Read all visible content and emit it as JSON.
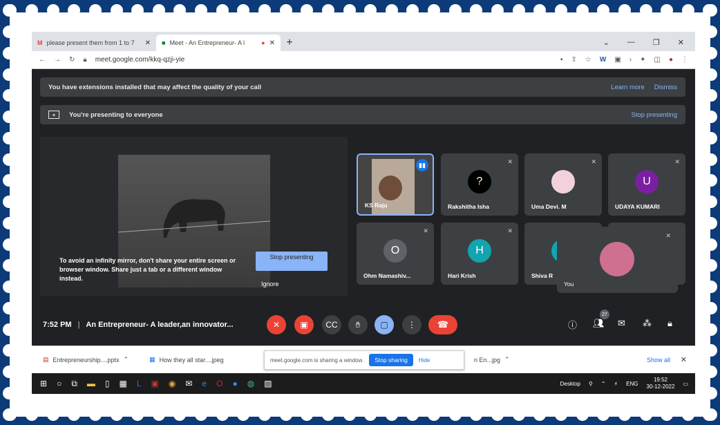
{
  "browser": {
    "tabs": [
      {
        "title": "please present them from 1 to 7",
        "icon": "gmail-icon"
      },
      {
        "title": "Meet - An Entrepreneur- A l",
        "icon": "meet-icon"
      }
    ],
    "url": "meet.google.com/kkq-qzji-yie"
  },
  "meet": {
    "ext_warning": "You have extensions installed that may affect the quality of your call",
    "learn_more": "Learn more",
    "dismiss": "Dismiss",
    "presenting": "You're presenting to everyone",
    "stop_presenting_link": "Stop presenting",
    "mirror_warning": "To avoid an infinity mirror, don't share your entire screen or browser window. Share just a tab or a different window instead.",
    "stop_presenting_btn": "Stop presenting",
    "ignore": "Ignore",
    "participants": [
      {
        "name": "KS Raju",
        "initial": "",
        "color": "#6b8",
        "speaking": true
      },
      {
        "name": "Rakshitha Isha",
        "initial": "?",
        "color": "#000"
      },
      {
        "name": "Uma Devi. M",
        "initial": "",
        "color": "#f3d1dc"
      },
      {
        "name": "UDAYA KUMARI",
        "initial": "U",
        "color": "#7b1fa2"
      },
      {
        "name": "Ohm Namashiv...",
        "initial": "O",
        "color": "#5f6368"
      },
      {
        "name": "Hari Krish",
        "initial": "H",
        "color": "#12a4af"
      },
      {
        "name": "Shiva R",
        "initial": "",
        "color": "#12a4af"
      }
    ],
    "self_label": "You",
    "time": "7:52 PM",
    "meeting_title": "An Entrepreneur- A leader,an innovator...",
    "participant_count": "27"
  },
  "downloads": {
    "items": [
      "Entrepreneurship....pptx",
      "How they all star....jpeg",
      "n En...jpg"
    ],
    "share_msg": "meet.google.com is sharing a window.",
    "stop_sharing": "Stop sharing",
    "hide": "Hide",
    "show_all": "Show all"
  },
  "taskbar": {
    "desktop": "Desktop",
    "lang": "ENG",
    "time": "19:52",
    "date": "30-12-2022"
  }
}
